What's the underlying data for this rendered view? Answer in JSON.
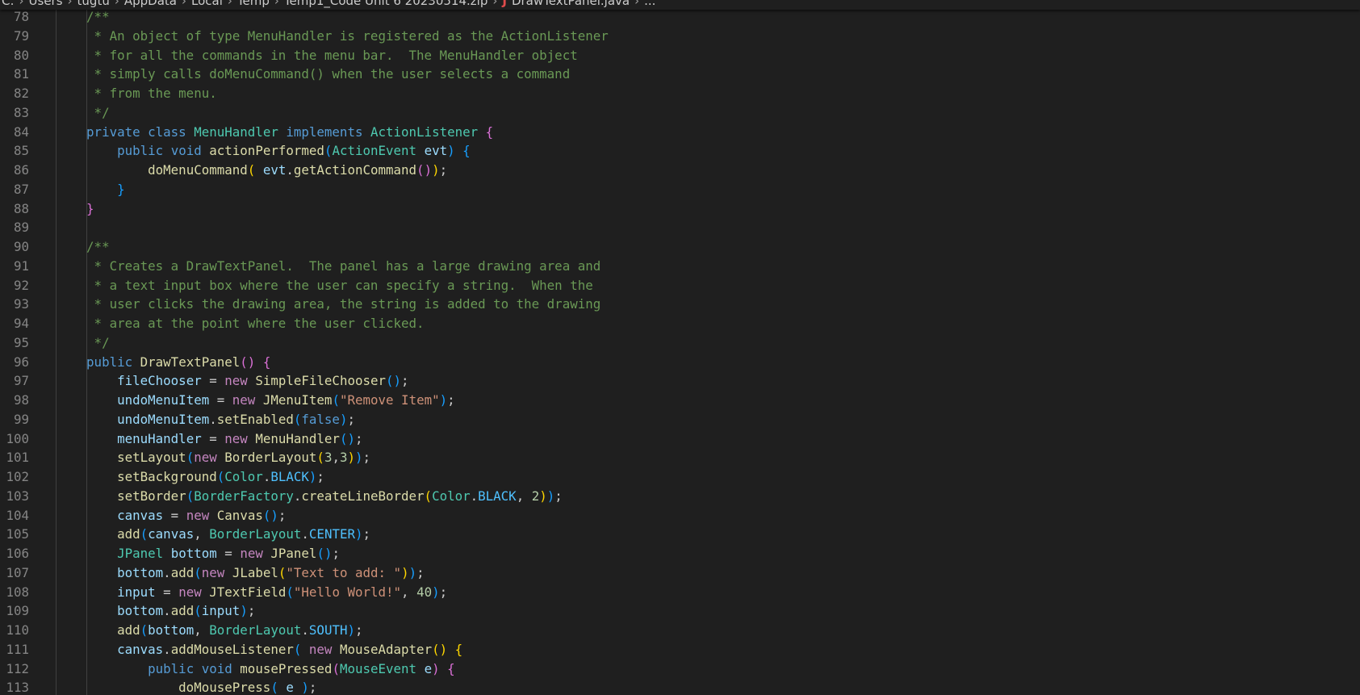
{
  "breadcrumb": {
    "items": [
      "C:",
      "Users",
      "tugtu",
      "AppData",
      "Local",
      "Temp",
      "Temp1_Code Unit 6 20230514.zip",
      "DrawTextPanel.java",
      "..."
    ],
    "separator": "›",
    "file_icon": "J"
  },
  "colors": {
    "background": "#1f1f1f",
    "comment": "#6a9955",
    "keyword": "#569cd6",
    "control_keyword": "#c586c0",
    "type": "#4ec9b0",
    "function": "#dcdcaa",
    "variable": "#9cdcfe",
    "constant": "#4fc1ff",
    "string": "#ce9178",
    "number": "#b5cea8",
    "line_number": "#858585"
  },
  "lines": [
    {
      "n": "78",
      "tokens": [
        [
          "    /**",
          "cmt"
        ]
      ]
    },
    {
      "n": "79",
      "tokens": [
        [
          "     * An object of type MenuHandler is registered as the ActionListener",
          "cmt"
        ]
      ]
    },
    {
      "n": "80",
      "tokens": [
        [
          "     * for all the commands in the menu bar.  The MenuHandler object",
          "cmt"
        ]
      ]
    },
    {
      "n": "81",
      "tokens": [
        [
          "     * simply calls doMenuCommand() when the user selects a command",
          "cmt"
        ]
      ]
    },
    {
      "n": "82",
      "tokens": [
        [
          "     * from the menu.",
          "cmt"
        ]
      ]
    },
    {
      "n": "83",
      "tokens": [
        [
          "     */",
          "cmt"
        ]
      ]
    },
    {
      "n": "84",
      "tokens": [
        [
          "    ",
          "punc"
        ],
        [
          "private",
          "kw"
        ],
        [
          " ",
          "punc"
        ],
        [
          "class",
          "kw"
        ],
        [
          " ",
          "punc"
        ],
        [
          "MenuHandler",
          "type"
        ],
        [
          " ",
          "punc"
        ],
        [
          "implements",
          "kw"
        ],
        [
          " ",
          "punc"
        ],
        [
          "ActionListener",
          "type"
        ],
        [
          " ",
          "punc"
        ],
        [
          "{",
          "b2"
        ]
      ]
    },
    {
      "n": "85",
      "tokens": [
        [
          "        ",
          "punc"
        ],
        [
          "public",
          "kw"
        ],
        [
          " ",
          "punc"
        ],
        [
          "void",
          "kw"
        ],
        [
          " ",
          "punc"
        ],
        [
          "actionPerformed",
          "fn"
        ],
        [
          "(",
          "b3"
        ],
        [
          "ActionEvent",
          "type"
        ],
        [
          " ",
          "punc"
        ],
        [
          "evt",
          "var"
        ],
        [
          ")",
          "b3"
        ],
        [
          " ",
          "punc"
        ],
        [
          "{",
          "b3"
        ]
      ]
    },
    {
      "n": "86",
      "tokens": [
        [
          "            ",
          "punc"
        ],
        [
          "doMenuCommand",
          "fn"
        ],
        [
          "(",
          "b1"
        ],
        [
          " ",
          "punc"
        ],
        [
          "evt",
          "var"
        ],
        [
          ".",
          "punc"
        ],
        [
          "getActionCommand",
          "fn"
        ],
        [
          "(",
          "b2"
        ],
        [
          ")",
          "b2"
        ],
        [
          ")",
          "b1"
        ],
        [
          ";",
          "punc"
        ]
      ]
    },
    {
      "n": "87",
      "tokens": [
        [
          "        ",
          "punc"
        ],
        [
          "}",
          "b3"
        ]
      ]
    },
    {
      "n": "88",
      "tokens": [
        [
          "    ",
          "punc"
        ],
        [
          "}",
          "b2"
        ]
      ]
    },
    {
      "n": "89",
      "tokens": []
    },
    {
      "n": "90",
      "tokens": [
        [
          "    /**",
          "cmt"
        ]
      ]
    },
    {
      "n": "91",
      "tokens": [
        [
          "     * Creates a DrawTextPanel.  The panel has a large drawing area and",
          "cmt"
        ]
      ]
    },
    {
      "n": "92",
      "tokens": [
        [
          "     * a text input box where the user can specify a string.  When the",
          "cmt"
        ]
      ]
    },
    {
      "n": "93",
      "tokens": [
        [
          "     * user clicks the drawing area, the string is added to the drawing",
          "cmt"
        ]
      ]
    },
    {
      "n": "94",
      "tokens": [
        [
          "     * area at the point where the user clicked.",
          "cmt"
        ]
      ]
    },
    {
      "n": "95",
      "tokens": [
        [
          "     */",
          "cmt"
        ]
      ]
    },
    {
      "n": "96",
      "tokens": [
        [
          "    ",
          "punc"
        ],
        [
          "public",
          "kw"
        ],
        [
          " ",
          "punc"
        ],
        [
          "DrawTextPanel",
          "fn"
        ],
        [
          "()",
          "b2"
        ],
        [
          " ",
          "punc"
        ],
        [
          "{",
          "b2"
        ]
      ]
    },
    {
      "n": "97",
      "tokens": [
        [
          "        ",
          "punc"
        ],
        [
          "fileChooser",
          "var"
        ],
        [
          " = ",
          "punc"
        ],
        [
          "new",
          "ctrl"
        ],
        [
          " ",
          "punc"
        ],
        [
          "SimpleFileChooser",
          "fn"
        ],
        [
          "()",
          "b3"
        ],
        [
          ";",
          "punc"
        ]
      ]
    },
    {
      "n": "98",
      "tokens": [
        [
          "        ",
          "punc"
        ],
        [
          "undoMenuItem",
          "var"
        ],
        [
          " = ",
          "punc"
        ],
        [
          "new",
          "ctrl"
        ],
        [
          " ",
          "punc"
        ],
        [
          "JMenuItem",
          "fn"
        ],
        [
          "(",
          "b3"
        ],
        [
          "\"Remove Item\"",
          "str"
        ],
        [
          ")",
          "b3"
        ],
        [
          ";",
          "punc"
        ]
      ]
    },
    {
      "n": "99",
      "tokens": [
        [
          "        ",
          "punc"
        ],
        [
          "undoMenuItem",
          "var"
        ],
        [
          ".",
          "punc"
        ],
        [
          "setEnabled",
          "fn"
        ],
        [
          "(",
          "b3"
        ],
        [
          "false",
          "kw"
        ],
        [
          ")",
          "b3"
        ],
        [
          ";",
          "punc"
        ]
      ]
    },
    {
      "n": "100",
      "tokens": [
        [
          "        ",
          "punc"
        ],
        [
          "menuHandler",
          "var"
        ],
        [
          " = ",
          "punc"
        ],
        [
          "new",
          "ctrl"
        ],
        [
          " ",
          "punc"
        ],
        [
          "MenuHandler",
          "fn"
        ],
        [
          "()",
          "b3"
        ],
        [
          ";",
          "punc"
        ]
      ]
    },
    {
      "n": "101",
      "tokens": [
        [
          "        ",
          "punc"
        ],
        [
          "setLayout",
          "fn"
        ],
        [
          "(",
          "b3"
        ],
        [
          "new",
          "ctrl"
        ],
        [
          " ",
          "punc"
        ],
        [
          "BorderLayout",
          "fn"
        ],
        [
          "(",
          "b1"
        ],
        [
          "3",
          "num"
        ],
        [
          ",",
          "punc"
        ],
        [
          "3",
          "num"
        ],
        [
          ")",
          "b1"
        ],
        [
          ")",
          "b3"
        ],
        [
          ";",
          "punc"
        ]
      ]
    },
    {
      "n": "102",
      "tokens": [
        [
          "        ",
          "punc"
        ],
        [
          "setBackground",
          "fn"
        ],
        [
          "(",
          "b3"
        ],
        [
          "Color",
          "type"
        ],
        [
          ".",
          "punc"
        ],
        [
          "BLACK",
          "const"
        ],
        [
          ")",
          "b3"
        ],
        [
          ";",
          "punc"
        ]
      ]
    },
    {
      "n": "103",
      "tokens": [
        [
          "        ",
          "punc"
        ],
        [
          "setBorder",
          "fn"
        ],
        [
          "(",
          "b3"
        ],
        [
          "BorderFactory",
          "type"
        ],
        [
          ".",
          "punc"
        ],
        [
          "createLineBorder",
          "fn"
        ],
        [
          "(",
          "b1"
        ],
        [
          "Color",
          "type"
        ],
        [
          ".",
          "punc"
        ],
        [
          "BLACK",
          "const"
        ],
        [
          ", ",
          "punc"
        ],
        [
          "2",
          "num"
        ],
        [
          ")",
          "b1"
        ],
        [
          ")",
          "b3"
        ],
        [
          ";",
          "punc"
        ]
      ]
    },
    {
      "n": "104",
      "tokens": [
        [
          "        ",
          "punc"
        ],
        [
          "canvas",
          "var"
        ],
        [
          " = ",
          "punc"
        ],
        [
          "new",
          "ctrl"
        ],
        [
          " ",
          "punc"
        ],
        [
          "Canvas",
          "fn"
        ],
        [
          "()",
          "b3"
        ],
        [
          ";",
          "punc"
        ]
      ]
    },
    {
      "n": "105",
      "tokens": [
        [
          "        ",
          "punc"
        ],
        [
          "add",
          "fn"
        ],
        [
          "(",
          "b3"
        ],
        [
          "canvas",
          "var"
        ],
        [
          ", ",
          "punc"
        ],
        [
          "BorderLayout",
          "type"
        ],
        [
          ".",
          "punc"
        ],
        [
          "CENTER",
          "const"
        ],
        [
          ")",
          "b3"
        ],
        [
          ";",
          "punc"
        ]
      ]
    },
    {
      "n": "106",
      "tokens": [
        [
          "        ",
          "punc"
        ],
        [
          "JPanel",
          "type"
        ],
        [
          " ",
          "punc"
        ],
        [
          "bottom",
          "var"
        ],
        [
          " = ",
          "punc"
        ],
        [
          "new",
          "ctrl"
        ],
        [
          " ",
          "punc"
        ],
        [
          "JPanel",
          "fn"
        ],
        [
          "()",
          "b3"
        ],
        [
          ";",
          "punc"
        ]
      ]
    },
    {
      "n": "107",
      "tokens": [
        [
          "        ",
          "punc"
        ],
        [
          "bottom",
          "var"
        ],
        [
          ".",
          "punc"
        ],
        [
          "add",
          "fn"
        ],
        [
          "(",
          "b3"
        ],
        [
          "new",
          "ctrl"
        ],
        [
          " ",
          "punc"
        ],
        [
          "JLabel",
          "fn"
        ],
        [
          "(",
          "b1"
        ],
        [
          "\"Text to add: \"",
          "str"
        ],
        [
          ")",
          "b1"
        ],
        [
          ")",
          "b3"
        ],
        [
          ";",
          "punc"
        ]
      ]
    },
    {
      "n": "108",
      "tokens": [
        [
          "        ",
          "punc"
        ],
        [
          "input",
          "var"
        ],
        [
          " = ",
          "punc"
        ],
        [
          "new",
          "ctrl"
        ],
        [
          " ",
          "punc"
        ],
        [
          "JTextField",
          "fn"
        ],
        [
          "(",
          "b3"
        ],
        [
          "\"Hello World!\"",
          "str"
        ],
        [
          ", ",
          "punc"
        ],
        [
          "40",
          "num"
        ],
        [
          ")",
          "b3"
        ],
        [
          ";",
          "punc"
        ]
      ]
    },
    {
      "n": "109",
      "tokens": [
        [
          "        ",
          "punc"
        ],
        [
          "bottom",
          "var"
        ],
        [
          ".",
          "punc"
        ],
        [
          "add",
          "fn"
        ],
        [
          "(",
          "b3"
        ],
        [
          "input",
          "var"
        ],
        [
          ")",
          "b3"
        ],
        [
          ";",
          "punc"
        ]
      ]
    },
    {
      "n": "110",
      "tokens": [
        [
          "        ",
          "punc"
        ],
        [
          "add",
          "fn"
        ],
        [
          "(",
          "b3"
        ],
        [
          "bottom",
          "var"
        ],
        [
          ", ",
          "punc"
        ],
        [
          "BorderLayout",
          "type"
        ],
        [
          ".",
          "punc"
        ],
        [
          "SOUTH",
          "const"
        ],
        [
          ")",
          "b3"
        ],
        [
          ";",
          "punc"
        ]
      ]
    },
    {
      "n": "111",
      "tokens": [
        [
          "        ",
          "punc"
        ],
        [
          "canvas",
          "var"
        ],
        [
          ".",
          "punc"
        ],
        [
          "addMouseListener",
          "fn"
        ],
        [
          "(",
          "b3"
        ],
        [
          " ",
          "punc"
        ],
        [
          "new",
          "ctrl"
        ],
        [
          " ",
          "punc"
        ],
        [
          "MouseAdapter",
          "fn"
        ],
        [
          "()",
          "b1"
        ],
        [
          " ",
          "punc"
        ],
        [
          "{",
          "b1"
        ]
      ]
    },
    {
      "n": "112",
      "tokens": [
        [
          "            ",
          "punc"
        ],
        [
          "public",
          "kw"
        ],
        [
          " ",
          "punc"
        ],
        [
          "void",
          "kw"
        ],
        [
          " ",
          "punc"
        ],
        [
          "mousePressed",
          "fn"
        ],
        [
          "(",
          "b2"
        ],
        [
          "MouseEvent",
          "type"
        ],
        [
          " ",
          "punc"
        ],
        [
          "e",
          "var"
        ],
        [
          ")",
          "b2"
        ],
        [
          " ",
          "punc"
        ],
        [
          "{",
          "b2"
        ]
      ]
    },
    {
      "n": "113",
      "tokens": [
        [
          "                ",
          "punc"
        ],
        [
          "doMousePress",
          "fn"
        ],
        [
          "(",
          "b3"
        ],
        [
          " ",
          "punc"
        ],
        [
          "e",
          "var"
        ],
        [
          " ",
          "punc"
        ],
        [
          ")",
          "b3"
        ],
        [
          ";",
          "punc"
        ]
      ]
    }
  ]
}
